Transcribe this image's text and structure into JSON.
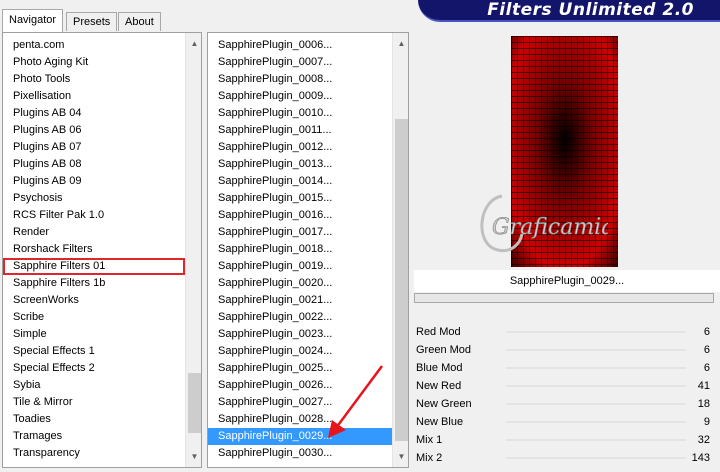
{
  "banner": "Filters Unlimited 2.0",
  "tabs": [
    {
      "label": "Navigator",
      "active": true
    },
    {
      "label": "Presets",
      "active": false
    },
    {
      "label": "About",
      "active": false
    }
  ],
  "categories": [
    "penta.com",
    "Photo Aging Kit",
    "Photo Tools",
    "Pixellisation",
    "Plugins AB 04",
    "Plugins AB 06",
    "Plugins AB 07",
    "Plugins AB 08",
    "Plugins AB 09",
    "Psychosis",
    "RCS Filter Pak 1.0",
    "Render",
    "Rorshack Filters",
    "Sapphire Filters 01",
    "Sapphire Filters 1b",
    "ScreenWorks",
    "Scribe",
    "Simple",
    "Special Effects 1",
    "Special Effects 2",
    "Sybia",
    "Tile & Mirror",
    "Toadies",
    "Tramages",
    "Transparency"
  ],
  "categories_highlighted_index": 13,
  "filters": [
    "SapphirePlugin_0006...",
    "SapphirePlugin_0007...",
    "SapphirePlugin_0008...",
    "SapphirePlugin_0009...",
    "SapphirePlugin_0010...",
    "SapphirePlugin_0011...",
    "SapphirePlugin_0012...",
    "SapphirePlugin_0013...",
    "SapphirePlugin_0014...",
    "SapphirePlugin_0015...",
    "SapphirePlugin_0016...",
    "SapphirePlugin_0017...",
    "SapphirePlugin_0018...",
    "SapphirePlugin_0019...",
    "SapphirePlugin_0020...",
    "SapphirePlugin_0021...",
    "SapphirePlugin_0022...",
    "SapphirePlugin_0023...",
    "SapphirePlugin_0024...",
    "SapphirePlugin_0025...",
    "SapphirePlugin_0026...",
    "SapphirePlugin_0027...",
    "SapphirePlugin_0028...",
    "SapphirePlugin_0029...",
    "SapphirePlugin_0030..."
  ],
  "filters_selected_index": 23,
  "preview_caption": "SapphirePlugin_0029...",
  "watermark": "Graficamia",
  "params": [
    {
      "label": "Red Mod",
      "value": "6"
    },
    {
      "label": "Green Mod",
      "value": "6"
    },
    {
      "label": "Blue Mod",
      "value": "6"
    },
    {
      "label": "New Red",
      "value": "41"
    },
    {
      "label": "New Green",
      "value": "18"
    },
    {
      "label": "New Blue",
      "value": "9"
    },
    {
      "label": "Mix 1",
      "value": "32"
    },
    {
      "label": "Mix 2",
      "value": "143"
    }
  ],
  "colors": {
    "banner_bg": "#13156b",
    "selection": "#3399ff",
    "highlight_box": "#e0262a",
    "annotation_arrow": "#e8141c",
    "preview_red": "#c80000"
  }
}
